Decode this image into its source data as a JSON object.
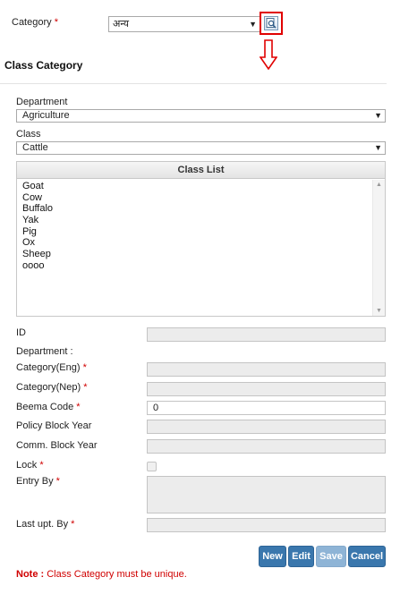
{
  "top": {
    "category_label": "Category",
    "required_mark": "*",
    "category_value": "अन्य"
  },
  "title": "Class Category",
  "department": {
    "label": "Department",
    "value": "Agriculture"
  },
  "class": {
    "label": "Class",
    "value": "Cattle"
  },
  "class_list": {
    "header": "Class List",
    "items": [
      "Goat",
      "Cow",
      "Buffalo",
      "Yak",
      "Pig",
      "Ox",
      "Sheep",
      "oooo"
    ]
  },
  "form": {
    "id_label": "ID",
    "department_label": "Department :",
    "category_eng_label": "Category(Eng)",
    "category_nep_label": "Category(Nep)",
    "beema_code_label": "Beema Code",
    "beema_code_value": "0",
    "policy_block_year_label": "Policy Block Year",
    "comm_block_year_label": "Comm. Block Year",
    "lock_label": "Lock",
    "entry_by_label": "Entry By",
    "last_upt_by_label": "Last upt. By",
    "required_mark": "*"
  },
  "buttons": {
    "new": "New",
    "edit": "Edit",
    "save": "Save",
    "cancel": "Cancel"
  },
  "note": {
    "prefix": "Note :",
    "text": "Class Category must be unique."
  },
  "colors": {
    "required": "#d00000",
    "button": "#3a77ad",
    "highlight_border": "#e00000"
  }
}
